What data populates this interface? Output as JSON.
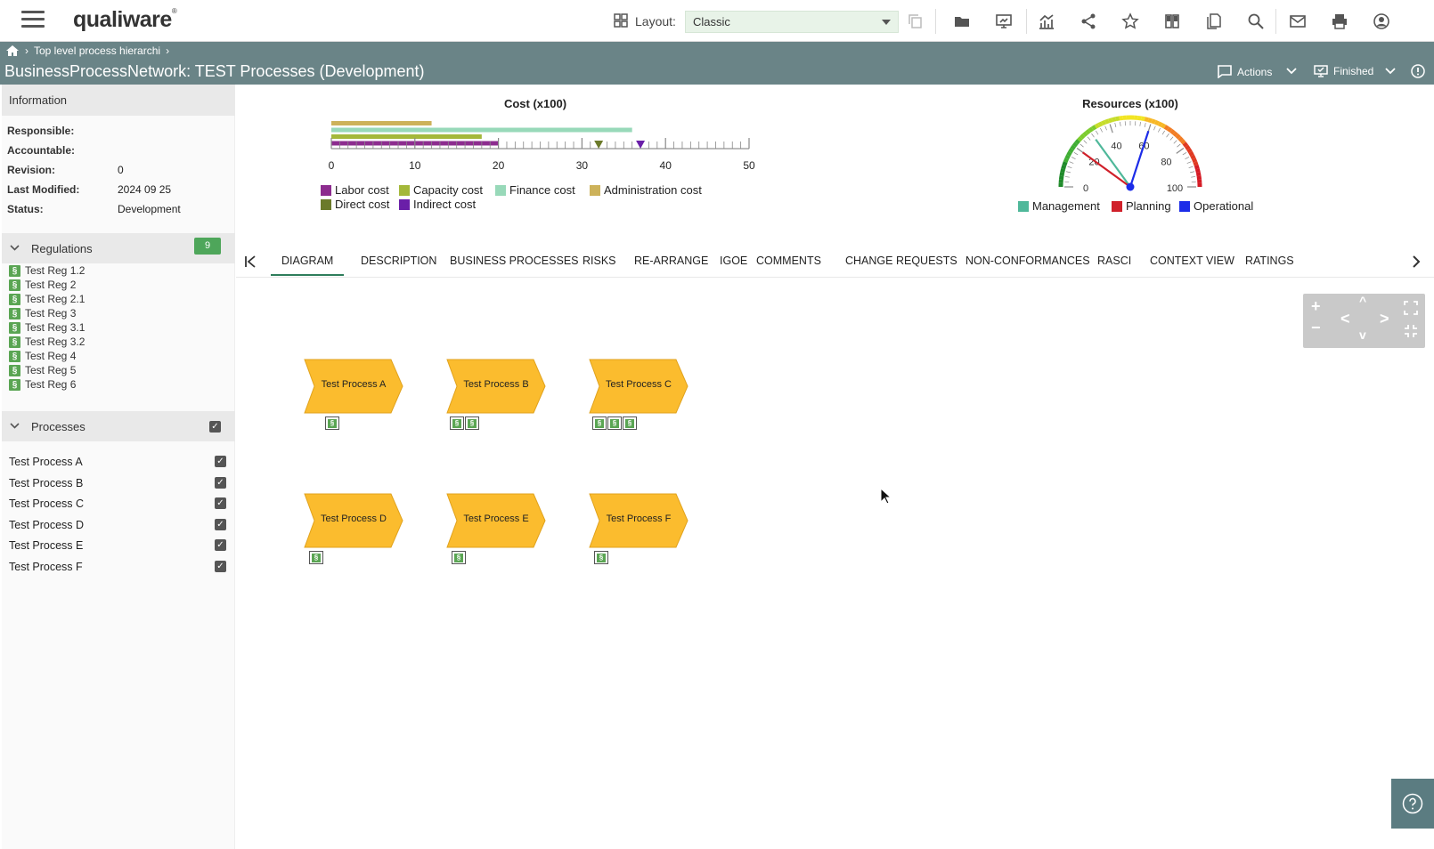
{
  "header": {
    "logo": "qualiware",
    "layout_label": "Layout:",
    "layout_value": "Classic"
  },
  "titlebar": {
    "breadcrumb": "Top level process hierarchi",
    "title": "BusinessProcessNetwork: TEST Processes (Development)",
    "actions_label": "Actions",
    "finished_label": "Finished"
  },
  "info": {
    "header": "Information",
    "rows": [
      {
        "k": "Responsible:",
        "v": ""
      },
      {
        "k": "Accountable:",
        "v": ""
      },
      {
        "k": "Revision:",
        "v": "0"
      },
      {
        "k": "Last Modified:",
        "v": "2024 09 25"
      },
      {
        "k": "Status:",
        "v": "Development"
      }
    ]
  },
  "regulations": {
    "header": "Regulations",
    "count": "9",
    "icon_glyph": "§",
    "items": [
      "Test Reg 1.2",
      "Test Reg 2",
      "Test Reg 2.1",
      "Test Reg 3",
      "Test Reg 3.1",
      "Test Reg 3.2",
      "Test Reg 4",
      "Test Reg 5",
      "Test Reg 6"
    ]
  },
  "processes": {
    "header": "Processes",
    "items": [
      "Test Process A",
      "Test Process B",
      "Test Process C",
      "Test Process D",
      "Test Process E",
      "Test Process F"
    ]
  },
  "chart_data": [
    {
      "type": "bar",
      "title": "Cost (x100)",
      "orientation": "horizontal",
      "xlim": [
        0,
        50
      ],
      "ticks": [
        "0",
        "10",
        "20",
        "30",
        "40",
        "50"
      ],
      "series": [
        {
          "name": "Administration cost",
          "value": 12,
          "color": "#cdb25a"
        },
        {
          "name": "Finance cost",
          "value": 36,
          "color": "#98d9b9"
        },
        {
          "name": "Capacity cost",
          "value": 18,
          "color": "#a4b83a"
        },
        {
          "name": "Labor cost",
          "value": 20,
          "color": "#8d2c8f"
        }
      ],
      "markers": [
        {
          "name": "Direct cost",
          "value": 32,
          "color": "#6b7a2a"
        },
        {
          "name": "Indirect cost",
          "value": 37,
          "color": "#6a1fa8"
        }
      ],
      "legend": [
        "Labor cost",
        "Capacity cost",
        "Finance cost",
        "Administration cost",
        "Direct cost",
        "Indirect cost"
      ],
      "legend_colors": [
        "#8d2c8f",
        "#a4b83a",
        "#98d9b9",
        "#cdb25a",
        "#6b7a2a",
        "#6a1fa8"
      ]
    },
    {
      "type": "gauge",
      "title": "Resources (x100)",
      "range": [
        0,
        100
      ],
      "ticks": [
        "0",
        "20",
        "40",
        "60",
        "80",
        "100"
      ],
      "needles": [
        {
          "name": "Management",
          "value": 30,
          "color": "#4fb89a"
        },
        {
          "name": "Planning",
          "value": 20,
          "color": "#d0202a"
        },
        {
          "name": "Operational",
          "value": 60,
          "color": "#1c2ce8"
        }
      ]
    }
  ],
  "tabs": [
    "DIAGRAM",
    "DESCRIPTION",
    "BUSINESS PROCESSES",
    "RISKS",
    "RE-ARRANGE",
    "IGOE",
    "COMMENTS",
    "CHANGE REQUESTS",
    "NON-CONFORMANCES",
    "RASCI",
    "CONTEXT VIEW",
    "RATINGS"
  ],
  "diagram": {
    "nodes": [
      {
        "label": "Test Process A",
        "regs": 1
      },
      {
        "label": "Test Process B",
        "regs": 2
      },
      {
        "label": "Test Process C",
        "regs": 3
      },
      {
        "label": "Test Process D",
        "regs": 1
      },
      {
        "label": "Test Process E",
        "regs": 1
      },
      {
        "label": "Test Process F",
        "regs": 1
      }
    ],
    "fill": "#fbbc2e"
  }
}
